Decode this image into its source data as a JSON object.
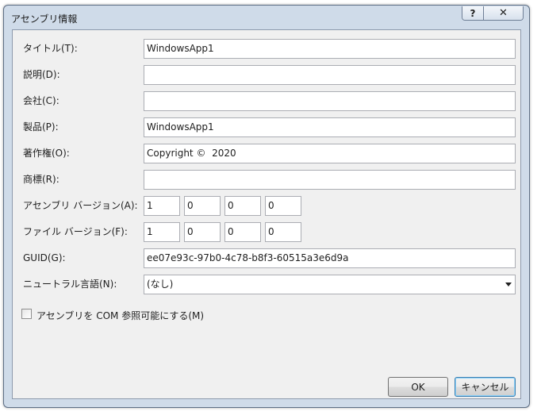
{
  "dialog": {
    "title": "アセンブリ情報",
    "help_glyph": "?",
    "close_glyph": "✕"
  },
  "fields": {
    "title_label": "タイトル(T):",
    "title_value": "WindowsApp1",
    "description_label": "説明(D):",
    "description_value": "",
    "company_label": "会社(C):",
    "company_value": "",
    "product_label": "製品(P):",
    "product_value": "WindowsApp1",
    "copyright_label": "著作権(O):",
    "copyright_value": "Copyright ©  2020",
    "trademark_label": "商標(R):",
    "trademark_value": "",
    "assembly_version_label": "アセンブリ バージョン(A):",
    "assembly_version": [
      "1",
      "0",
      "0",
      "0"
    ],
    "file_version_label": "ファイル バージョン(F):",
    "file_version": [
      "1",
      "0",
      "0",
      "0"
    ],
    "guid_label": "GUID(G):",
    "guid_value": "ee07e93c-97b0-4c78-b8f3-60515a3e6d9a",
    "neutral_language_label": "ニュートラル言語(N):",
    "neutral_language_value": "(なし)"
  },
  "com_visible": {
    "label": "アセンブリを COM 参照可能にする(M)",
    "checked": false
  },
  "buttons": {
    "ok": "OK",
    "cancel": "キャンセル"
  }
}
